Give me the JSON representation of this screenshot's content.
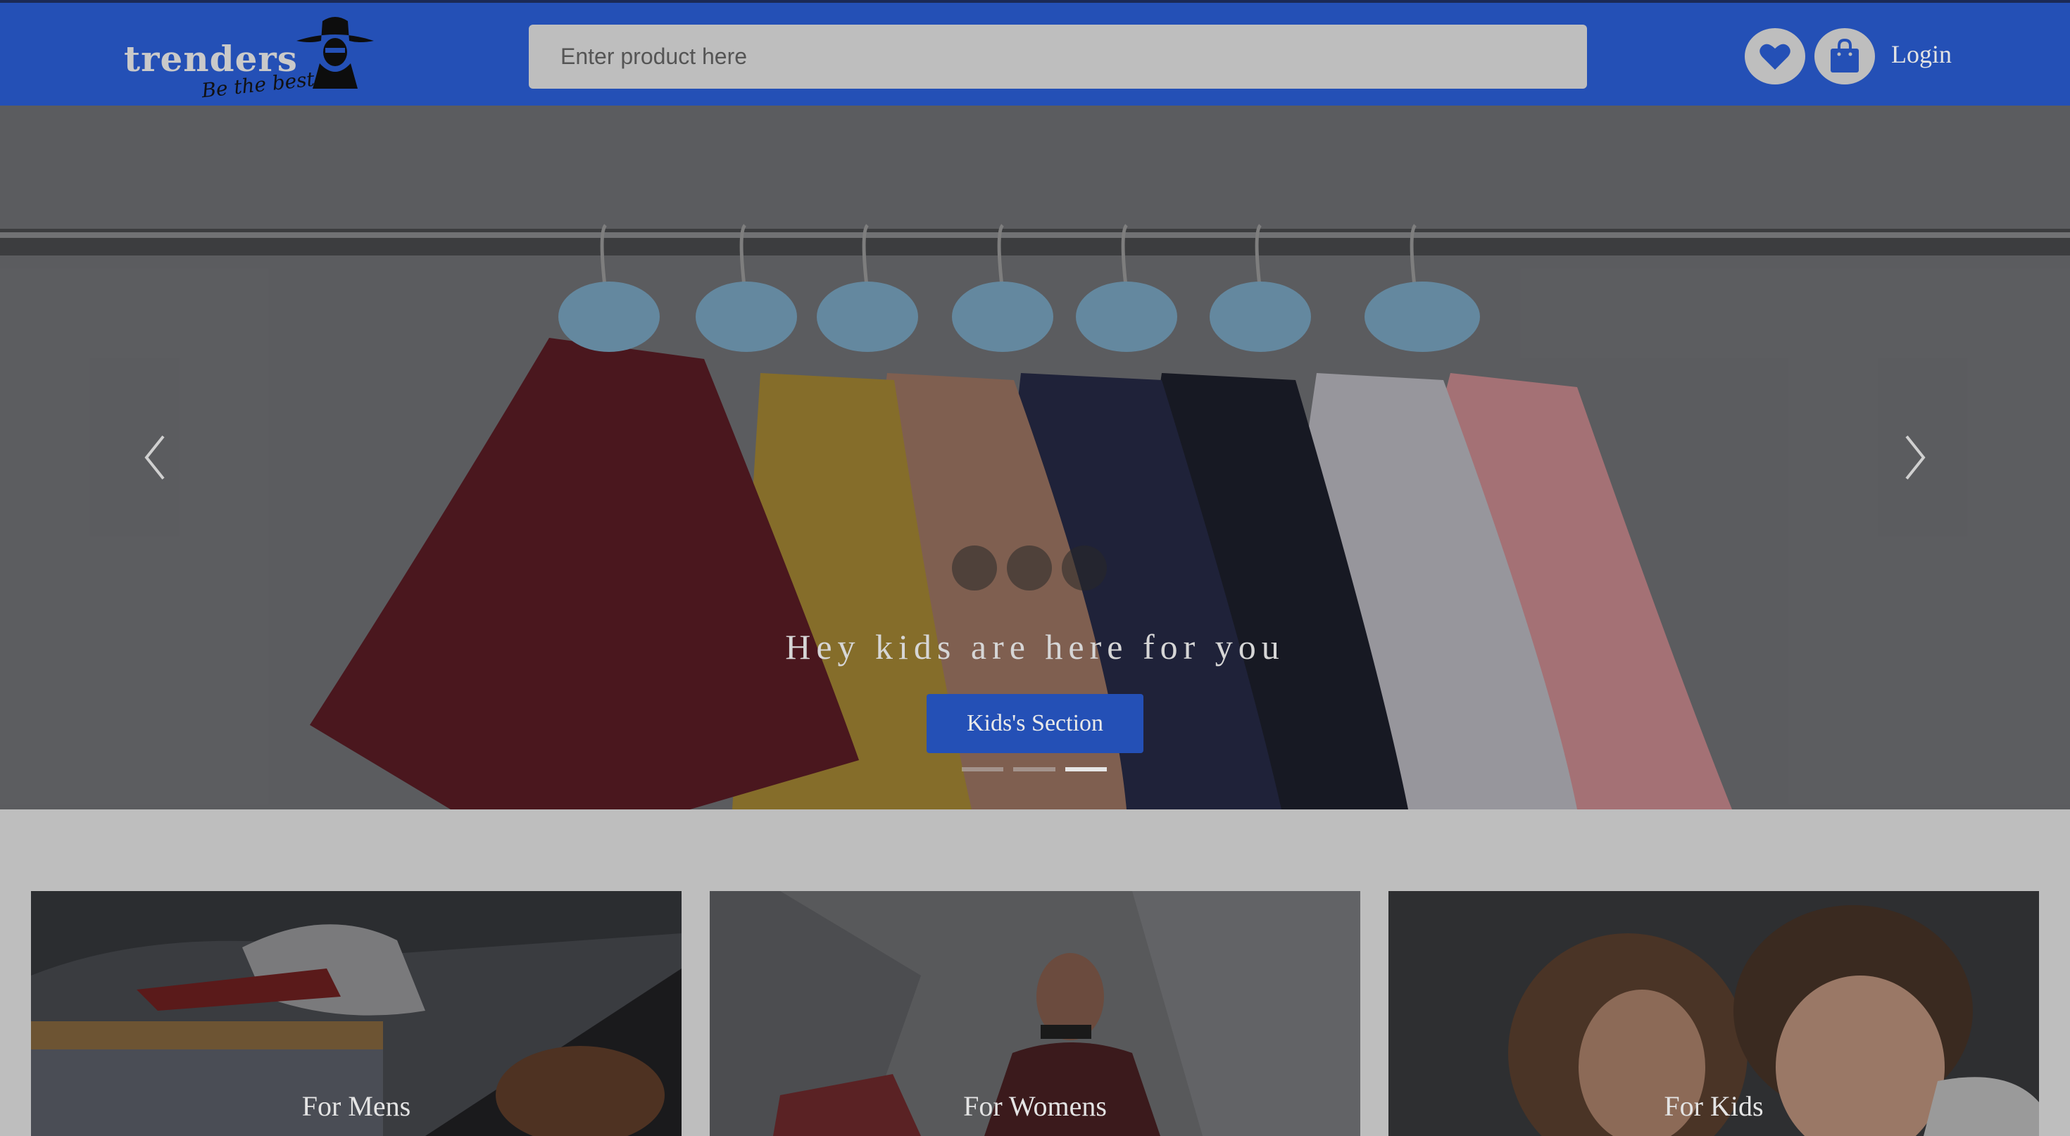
{
  "brand": {
    "name": "trenders",
    "tagline": "Be the best"
  },
  "header": {
    "search_placeholder": "Enter product here",
    "wishlist_icon": "heart-icon",
    "cart_icon": "shopping-bag-icon",
    "login_label": "Login"
  },
  "hero": {
    "caption": "Hey kids are here for you",
    "button_label": "Kids's Section",
    "active_slide": 3,
    "slide_count": 3,
    "prev_icon": "chevron-left-icon",
    "next_icon": "chevron-right-icon"
  },
  "categories": [
    {
      "label": "For Mens"
    },
    {
      "label": "For Womens"
    },
    {
      "label": "For Kids"
    }
  ],
  "colors": {
    "primary": "#2450b6",
    "page_background": "#bebebe",
    "text_light": "#e3e3e3"
  }
}
